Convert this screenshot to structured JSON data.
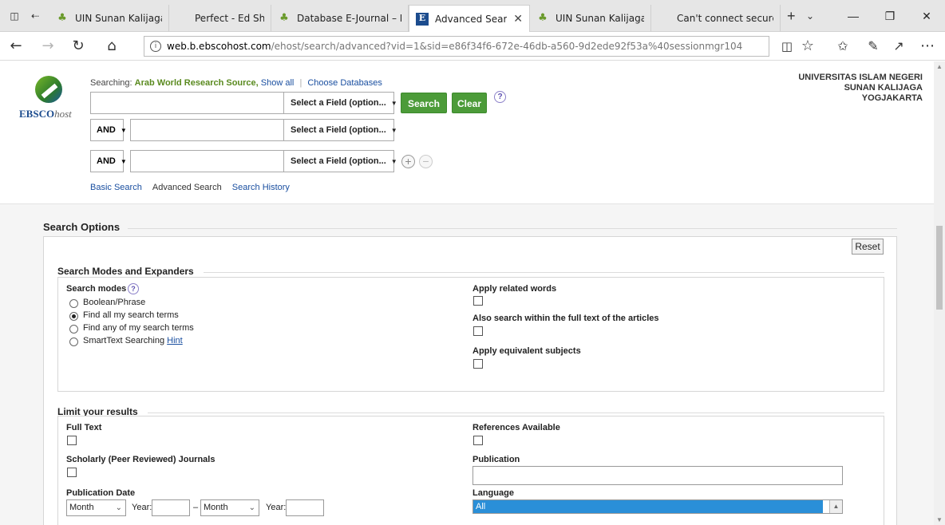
{
  "browser": {
    "tabs": [
      {
        "label": "UIN Sunan Kalijaga",
        "icon": "leaf-icon"
      },
      {
        "label": "Perfect - Ed Sheeran (L",
        "icon": "page-icon"
      },
      {
        "label": "Database E-Journal – P",
        "icon": "leaf-icon"
      },
      {
        "label": "Advanced Search: E",
        "icon": "ebsco-icon",
        "active": true
      },
      {
        "label": "UIN Sunan Kalijaga",
        "icon": "leaf-icon"
      },
      {
        "label": "Can't connect securely",
        "icon": "page-icon"
      }
    ],
    "url_host": "web.b.ebscohost.com",
    "url_path": "/ehost/search/advanced?vid=1&sid=e86f34f6-672e-46db-a560-9d2ede92f53a%40sessionmgr104"
  },
  "header": {
    "logo_text": "EBSCO",
    "logo_suffix": "host",
    "searching_label": "Searching:",
    "database": "Arab World Research Source,",
    "show_all": "Show all",
    "choose_databases": "Choose Databases",
    "institution": [
      "UNIVERSITAS ISLAM NEGERI",
      "SUNAN KALIJAGA",
      "YOGJAKARTA"
    ]
  },
  "search": {
    "field_placeholder": "Select a Field (option...",
    "operator": "AND",
    "search_button": "Search",
    "clear_button": "Clear",
    "help": "?"
  },
  "links": {
    "basic": "Basic Search",
    "advanced": "Advanced Search",
    "history": "Search History"
  },
  "options": {
    "title": "Search Options",
    "reset": "Reset",
    "modes_title": "Search Modes and Expanders",
    "modes_label": "Search modes",
    "modes": [
      {
        "label": "Boolean/Phrase",
        "selected": false
      },
      {
        "label": "Find all my search terms",
        "selected": true
      },
      {
        "label": "Find any of my search terms",
        "selected": false
      },
      {
        "label": "SmartText Searching",
        "selected": false
      }
    ],
    "hint": "Hint",
    "expanders": [
      "Apply related words",
      "Also search within the full text of the articles",
      "Apply equivalent subjects"
    ],
    "limit_title": "Limit your results",
    "full_text": "Full Text",
    "scholarly": "Scholarly (Peer Reviewed) Journals",
    "pub_date": "Publication Date",
    "month": "Month",
    "year_label": "Year:",
    "dash": "–",
    "references": "References Available",
    "publication": "Publication",
    "language": "Language",
    "language_selected": "All"
  }
}
